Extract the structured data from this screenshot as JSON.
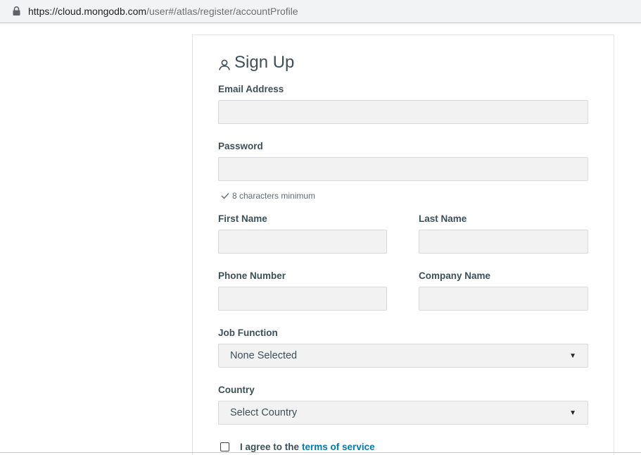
{
  "browser": {
    "url_host": "https://cloud.mongodb.com",
    "url_path": "/user#/atlas/register/accountProfile"
  },
  "form": {
    "title": "Sign Up",
    "title_icon": "user-icon",
    "email_label": "Email Address",
    "email_value": "",
    "password_label": "Password",
    "password_value": "",
    "password_hint": "8 characters minimum",
    "first_name_label": "First Name",
    "first_name_value": "",
    "last_name_label": "Last Name",
    "last_name_value": "",
    "phone_label": "Phone Number",
    "phone_value": "",
    "company_label": "Company Name",
    "company_value": "",
    "job_function_label": "Job Function",
    "job_function_value": "None Selected",
    "country_label": "Country",
    "country_value": "Select Country",
    "agree_text": "I agree to the",
    "terms_link": "terms of service"
  },
  "colors": {
    "link": "#007cad",
    "input_bg": "#f2f2f2",
    "text": "#3d4f58"
  }
}
